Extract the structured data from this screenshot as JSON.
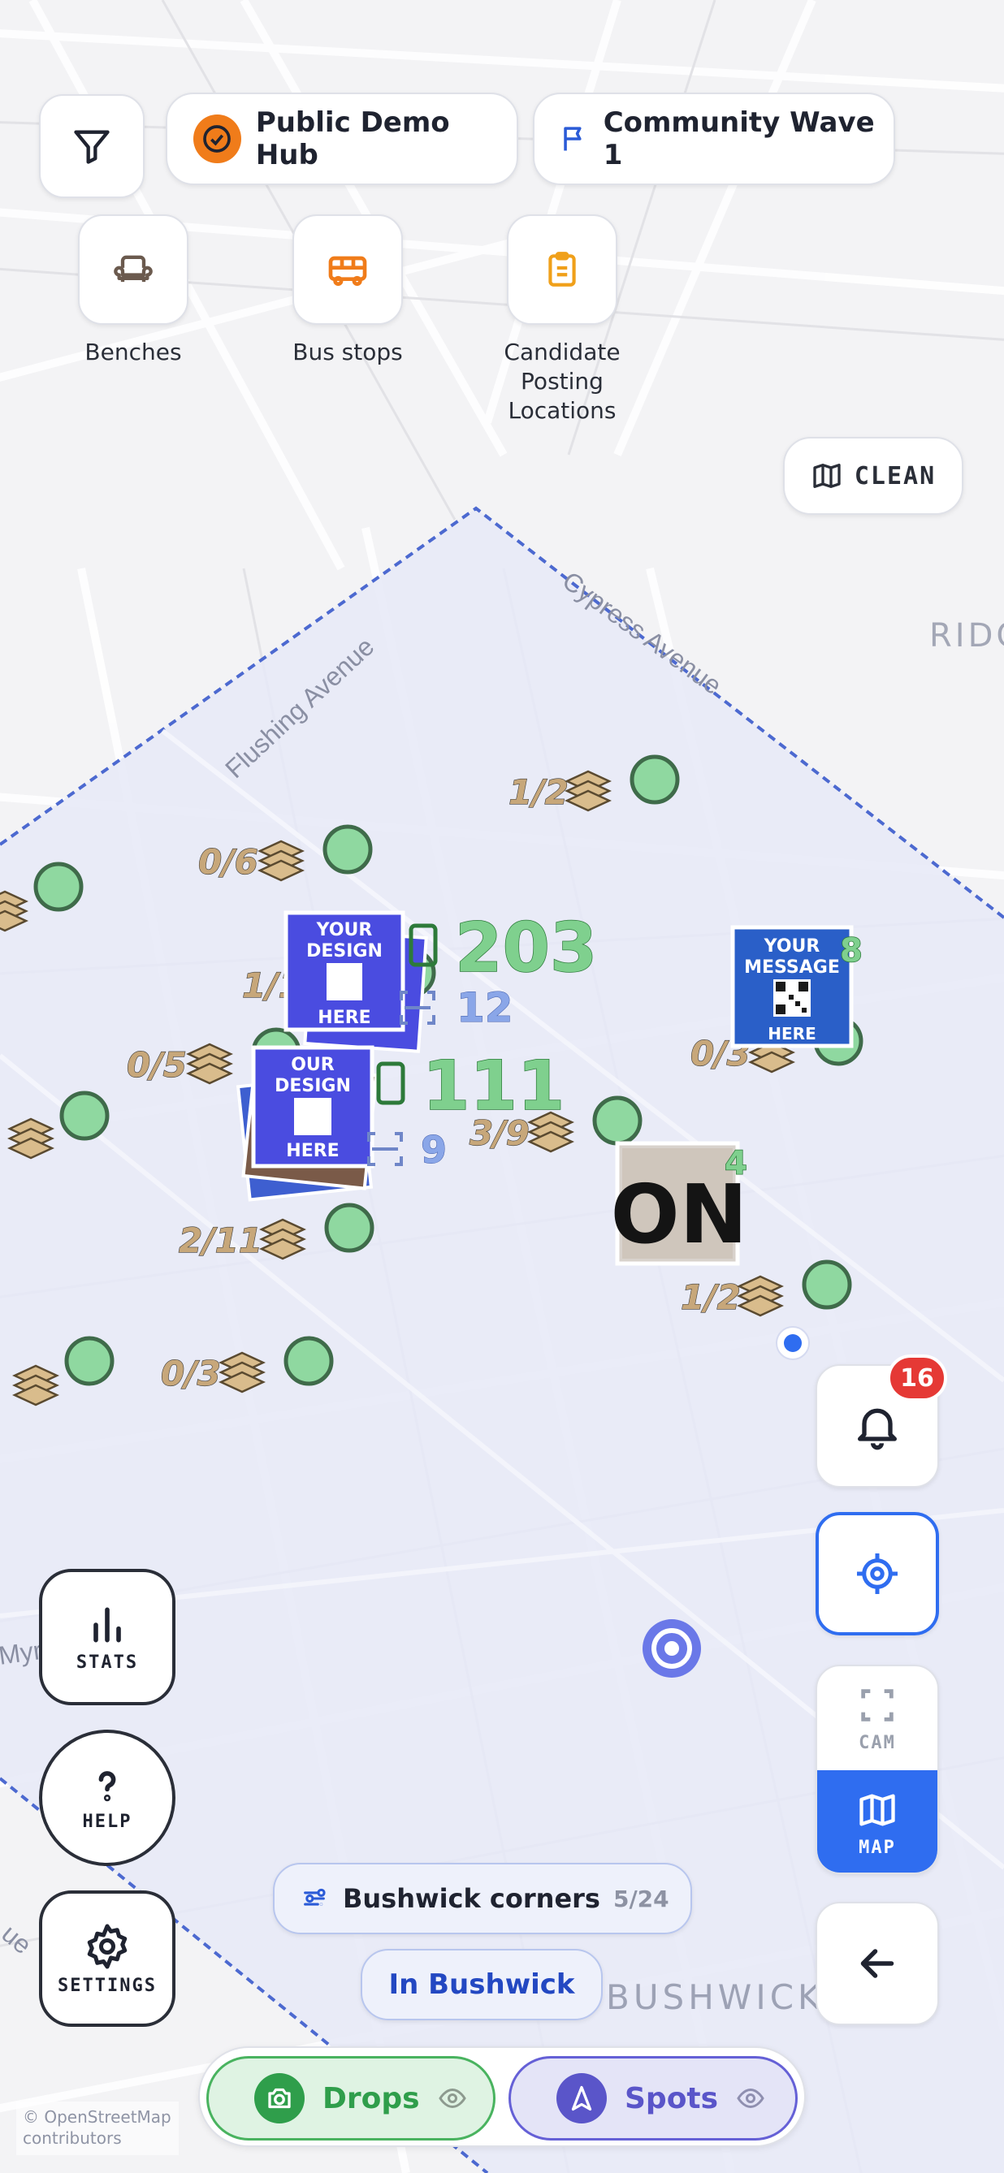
{
  "filter_button": {
    "icon": "filter-icon"
  },
  "hub": {
    "label": "Public Demo Hub",
    "icon": "check-circle-icon",
    "accent": "#f07c1a"
  },
  "campaign": {
    "label": "Community Wave 1",
    "icon": "flag-icon",
    "accent": "#2b5bd7"
  },
  "layers": [
    {
      "label": "Benches",
      "icon": "armchair-icon",
      "color": "#6b5a4e"
    },
    {
      "label": "Bus stops",
      "icon": "bus-icon",
      "color": "#f07c1a"
    },
    {
      "label": "Candidate Posting Locations",
      "icon": "clipboard-icon",
      "color": "#f0a01a"
    }
  ],
  "clean_button": {
    "label": "CLEAN",
    "icon": "map-icon"
  },
  "map": {
    "street_labels": [
      "Flushing Avenue",
      "Cypress Avenue",
      "Myrtle Avenue",
      "ue"
    ],
    "neighborhood_labels": [
      "RIDG",
      "BUSHWICK"
    ],
    "poster_texts": [
      "YOUR",
      "DESIGN",
      "HERE",
      "OUR",
      "YOUR",
      "MESSAGE",
      "HERE",
      "ON"
    ],
    "clusters": [
      "1/2",
      "0/6",
      "1/18",
      "0/5",
      "3/9",
      "0/3",
      "2/11",
      "1/2",
      "0/3"
    ],
    "big_counts": [
      "203",
      "111"
    ],
    "small_counts": [
      "12",
      "9"
    ],
    "badges": [
      "8",
      "4"
    ],
    "attribution": [
      "© OpenStreetMap",
      "contributors"
    ],
    "zone_color": "#e6e9f7",
    "marker_color": "#8fd8a0"
  },
  "notifications": {
    "icon": "bell-icon",
    "count": "16"
  },
  "locate_button": {
    "icon": "crosshair-icon"
  },
  "view_toggle": {
    "cam_label": "CAM",
    "map_label": "MAP",
    "active": "MAP"
  },
  "back_button": {
    "icon": "arrow-left-icon"
  },
  "left_buttons": [
    {
      "label": "STATS",
      "icon": "bar-chart-icon"
    },
    {
      "label": "HELP",
      "icon": "question-icon"
    },
    {
      "label": "SETTINGS",
      "icon": "gear-icon"
    }
  ],
  "route": {
    "label": "Bushwick corners",
    "progress": "5/24",
    "icon": "route-icon"
  },
  "area_chip": {
    "label": "In Bushwick"
  },
  "tabs": [
    {
      "label": "Drops",
      "icon": "camera-icon",
      "color": "#2f9e4b"
    },
    {
      "label": "Spots",
      "icon": "navigation-icon",
      "color": "#5a55c9"
    }
  ]
}
